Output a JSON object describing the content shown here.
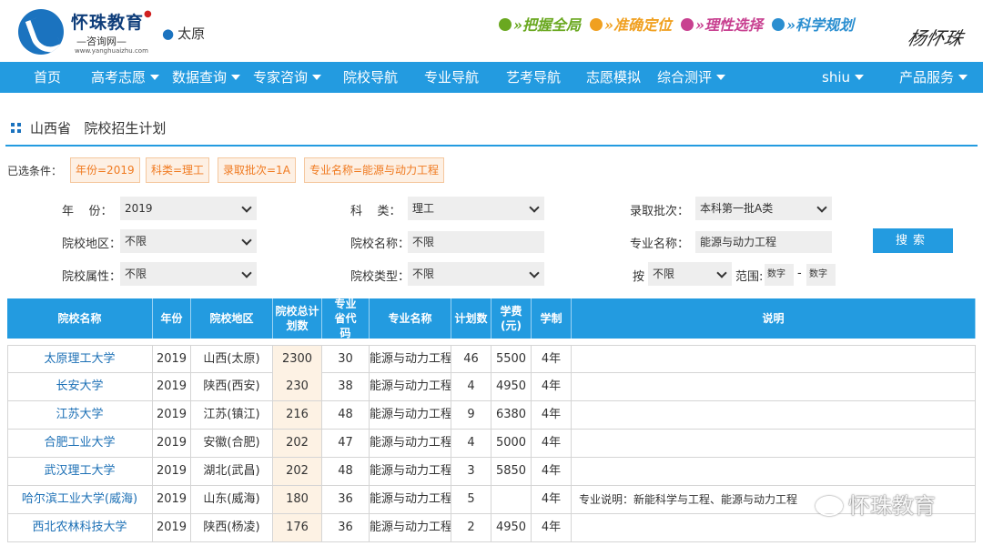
{
  "brand": {
    "name": "怀珠教育",
    "sub": "咨询网",
    "url": "www.yanghuaizhu.com",
    "location": "太原"
  },
  "slogans": [
    {
      "text": "»把握全局",
      "color": "#6aa820"
    },
    {
      "text": "»准确定位",
      "color": "#f0a020"
    },
    {
      "text": "»理性选择",
      "color": "#c84090"
    },
    {
      "text": "»科学规划",
      "color": "#2a8ed0"
    }
  ],
  "signature": "杨怀珠",
  "nav": [
    {
      "label": "首页",
      "dropdown": false
    },
    {
      "label": "高考志愿",
      "dropdown": true
    },
    {
      "label": "数据查询",
      "dropdown": true
    },
    {
      "label": "专家咨询",
      "dropdown": true
    },
    {
      "label": "院校导航",
      "dropdown": false
    },
    {
      "label": "专业导航",
      "dropdown": false
    },
    {
      "label": "艺考导航",
      "dropdown": false
    },
    {
      "label": "志愿模拟",
      "dropdown": false
    },
    {
      "label": "综合测评",
      "dropdown": true
    },
    {
      "label": "shiu",
      "dropdown": true
    },
    {
      "label": "产品服务",
      "dropdown": true
    }
  ],
  "page": {
    "province": "山西省",
    "title": "院校招生计划"
  },
  "chips_label": "已选条件：",
  "chips": [
    "年份=2019",
    "科类=理工",
    "录取批次=1A",
    "专业名称=能源与动力工程"
  ],
  "filters": {
    "year_label": "年    份：",
    "year_value": "2019",
    "subject_label": "科    类：",
    "subject_value": "理工",
    "batch_label": "录取批次：",
    "batch_value": "本科第一批A类",
    "region_label": "院校地区：",
    "region_value": "不限",
    "school_name_label": "院校名称：",
    "school_name_value": "不限",
    "major_label": "专业名称：",
    "major_value": "能源与动力工程",
    "attr_label": "院校属性：",
    "attr_value": "不限",
    "type_label": "院校类型：",
    "type_value": "不限",
    "by_label": "按",
    "by_value": "不限",
    "range_label": "范围:",
    "range_from": "数字",
    "range_dash": "-",
    "range_to": "数字",
    "search_label": "搜索"
  },
  "table": {
    "headers": [
      "院校名称",
      "年份",
      "院校地区",
      "院校总计划数",
      "专业省代码",
      "专业名称",
      "计划数",
      "学费(元)",
      "学制",
      "说明"
    ],
    "rows": [
      [
        "太原理工大学",
        "2019",
        "山西(太原)",
        "2300",
        "30",
        "能源与动力工程",
        "46",
        "5500",
        "4年",
        ""
      ],
      [
        "长安大学",
        "2019",
        "陕西(西安)",
        "230",
        "38",
        "能源与动力工程",
        "4",
        "4950",
        "4年",
        ""
      ],
      [
        "江苏大学",
        "2019",
        "江苏(镇江)",
        "216",
        "48",
        "能源与动力工程",
        "9",
        "6380",
        "4年",
        ""
      ],
      [
        "合肥工业大学",
        "2019",
        "安徽(合肥)",
        "202",
        "47",
        "能源与动力工程",
        "4",
        "5000",
        "4年",
        ""
      ],
      [
        "武汉理工大学",
        "2019",
        "湖北(武昌)",
        "202",
        "48",
        "能源与动力工程",
        "3",
        "5850",
        "4年",
        ""
      ],
      [
        "哈尔滨工业大学(威海)",
        "2019",
        "山东(威海)",
        "180",
        "36",
        "能源与动力工程",
        "5",
        "",
        "4年",
        "专业说明：新能科学与工程、能源与动力工程"
      ],
      [
        "西北农林科技大学",
        "2019",
        "陕西(杨凌)",
        "176",
        "36",
        "能源与动力工程",
        "2",
        "4950",
        "4年",
        ""
      ]
    ]
  },
  "watermark": "怀珠教育"
}
